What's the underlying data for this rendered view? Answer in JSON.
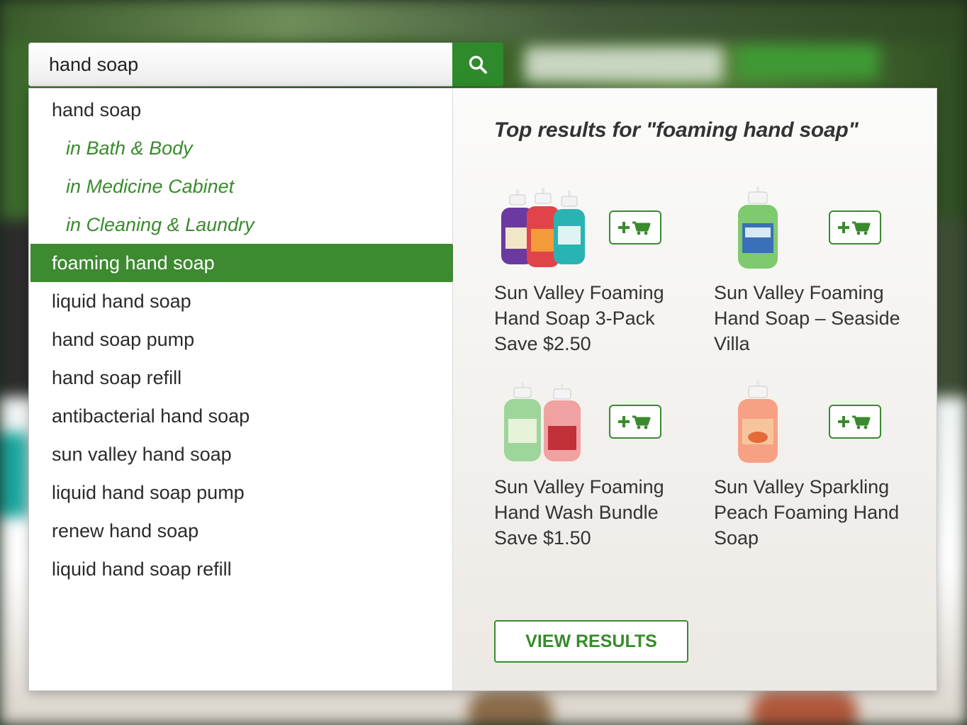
{
  "search": {
    "value": "hand soap",
    "button_icon": "search-icon"
  },
  "suggestions": [
    {
      "label": "hand soap",
      "type": "term",
      "active": false
    },
    {
      "label": "in Bath & Body",
      "type": "category",
      "active": false
    },
    {
      "label": "in Medicine Cabinet",
      "type": "category",
      "active": false
    },
    {
      "label": "in Cleaning & Laundry",
      "type": "category",
      "active": false
    },
    {
      "label": "foaming hand soap",
      "type": "term",
      "active": true
    },
    {
      "label": "liquid hand soap",
      "type": "term",
      "active": false
    },
    {
      "label": "hand soap pump",
      "type": "term",
      "active": false
    },
    {
      "label": "hand soap refill",
      "type": "term",
      "active": false
    },
    {
      "label": "antibacterial hand soap",
      "type": "term",
      "active": false
    },
    {
      "label": "sun valley hand soap",
      "type": "term",
      "active": false
    },
    {
      "label": "liquid hand soap pump",
      "type": "term",
      "active": false
    },
    {
      "label": "renew hand soap",
      "type": "term",
      "active": false
    },
    {
      "label": "liquid hand soap refill",
      "type": "term",
      "active": false
    }
  ],
  "results": {
    "title": "Top results for \"foaming hand soap\"",
    "products": [
      {
        "name": "Sun Valley Foaming Hand Soap 3-Pack Save $2.50",
        "image": "soap-3pack-image",
        "cart_icon": "add-to-cart-icon"
      },
      {
        "name": "Sun Valley Foaming Hand Soap – Seaside Villa",
        "image": "soap-seaside-image",
        "cart_icon": "add-to-cart-icon"
      },
      {
        "name": "Sun Valley Foaming Hand Wash Bundle Save $1.50",
        "image": "soap-bundle-image",
        "cart_icon": "add-to-cart-icon"
      },
      {
        "name": "Sun Valley Sparkling Peach Foaming Hand Soap",
        "image": "soap-peach-image",
        "cart_icon": "add-to-cart-icon"
      }
    ],
    "view_results_label": "VIEW RESULTS"
  },
  "colors": {
    "accent": "#3d8a30",
    "category_text": "#3a8a2e",
    "text": "#2b2b2b"
  }
}
